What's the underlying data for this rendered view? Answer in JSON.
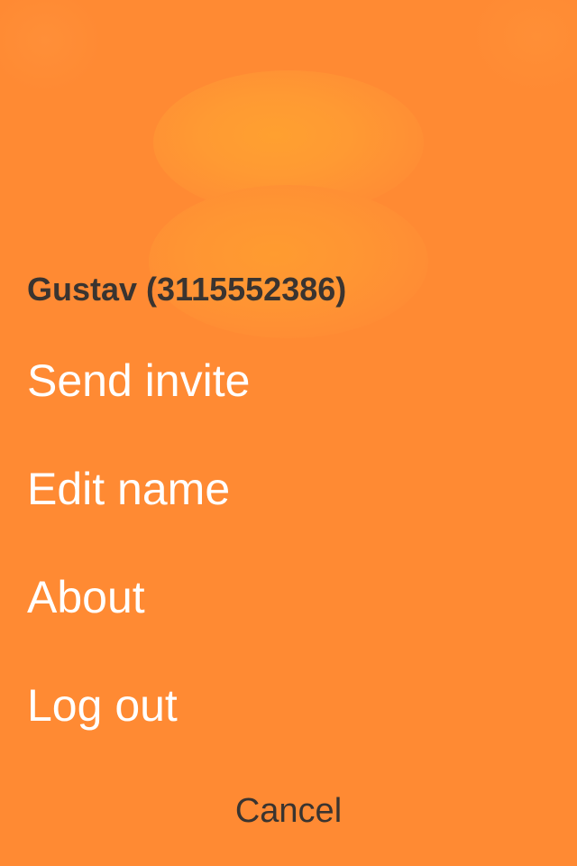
{
  "contact": {
    "title": "Gustav (3115552386)"
  },
  "menu": {
    "items": [
      {
        "label": "Send invite"
      },
      {
        "label": "Edit name"
      },
      {
        "label": "About"
      },
      {
        "label": "Log out"
      }
    ],
    "cancel_label": "Cancel"
  },
  "colors": {
    "background": "#ff8a33",
    "primary_text": "#ffffff",
    "secondary_text": "#3a3430"
  }
}
